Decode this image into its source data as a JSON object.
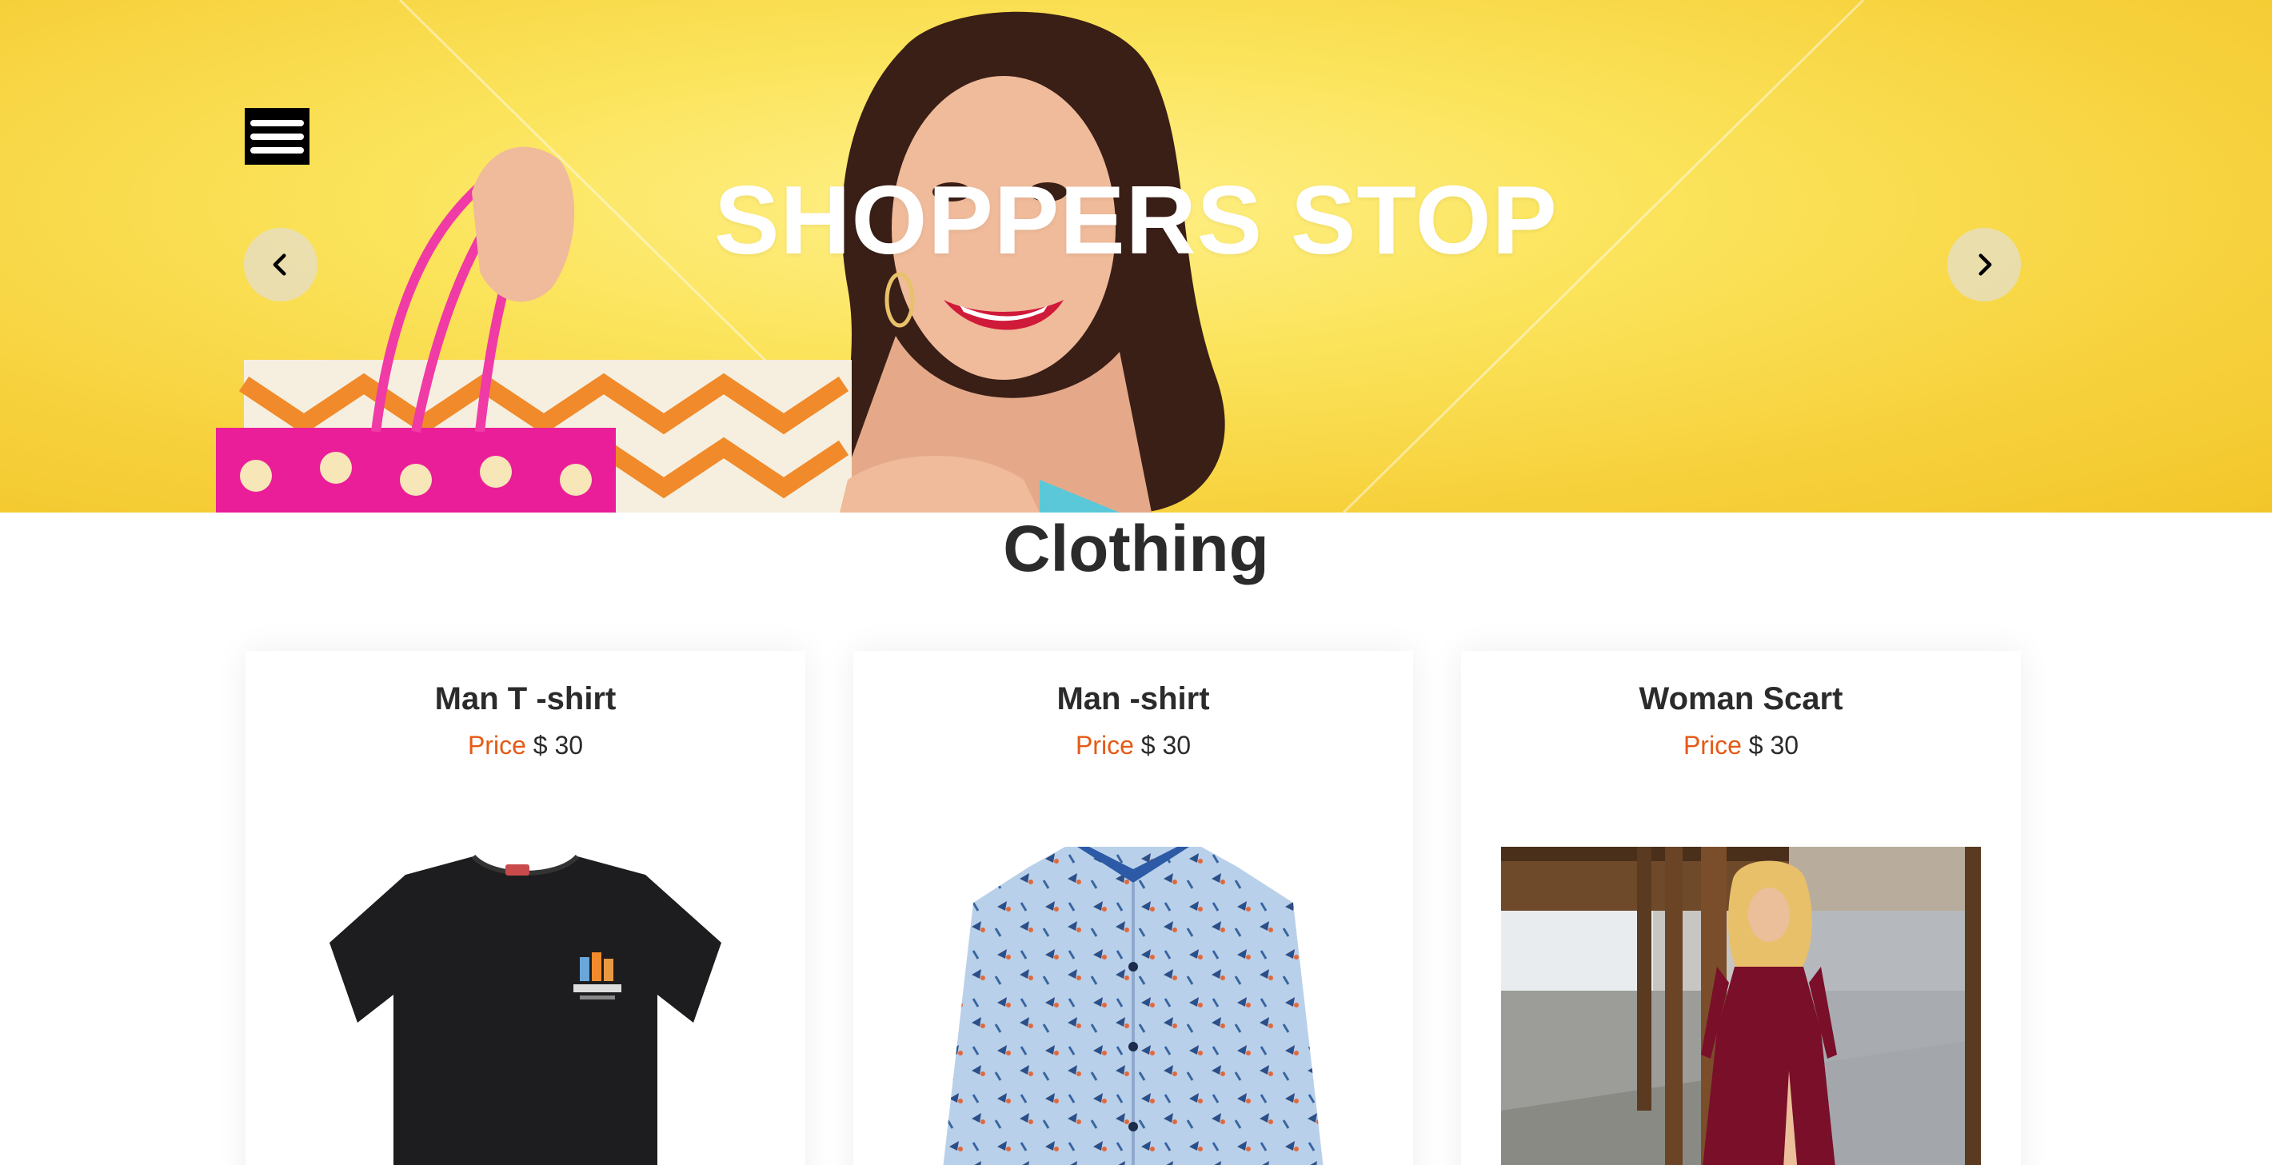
{
  "hero": {
    "title": "SHOPPERS STOP",
    "menu_icon": "hamburger-menu-icon",
    "prev_icon": "chevron-left-icon",
    "next_icon": "chevron-right-icon",
    "background_color": "#f7d23e"
  },
  "section": {
    "title": "Clothing"
  },
  "products": [
    {
      "name": "Man T -shirt",
      "price_label": "Price",
      "price_value": "$ 30",
      "image": "black-t-shirt-image"
    },
    {
      "name": "Man -shirt",
      "price_label": "Price",
      "price_value": "$ 30",
      "image": "printed-blue-shirt-image"
    },
    {
      "name": "Woman Scart",
      "price_label": "Price",
      "price_value": "$ 30",
      "image": "woman-red-dress-image"
    }
  ],
  "colors": {
    "price_label": "#e45a15",
    "text": "#2b2b2b",
    "menu_bg": "#000000"
  }
}
